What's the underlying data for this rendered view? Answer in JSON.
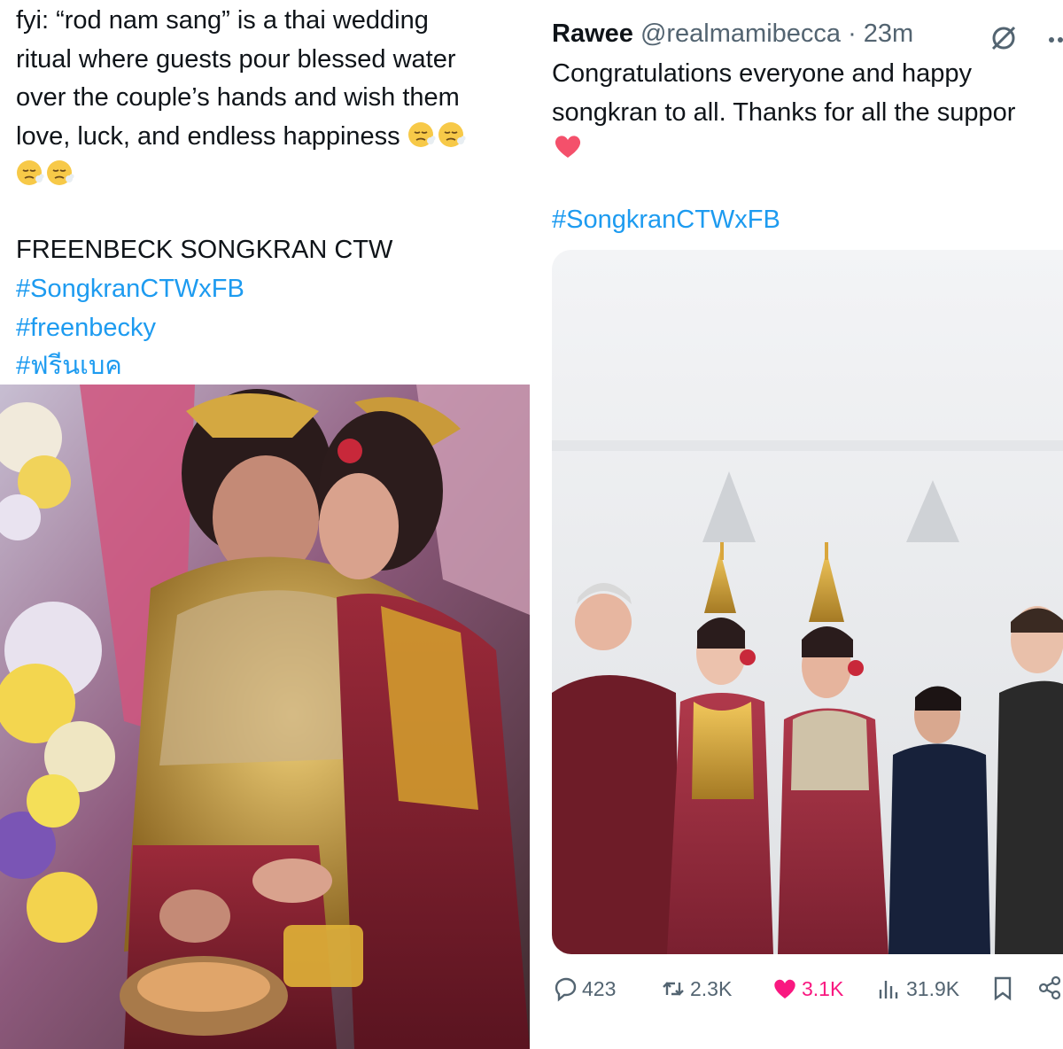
{
  "left_post": {
    "lines": [
      "fyi: “rod nam sang” is a thai wedding",
      "ritual where guests pour blessed water",
      "over the couple’s hands and wish them",
      "love, luck, and endless happiness"
    ],
    "emoji_name": "face-exhaling",
    "emoji_count": 4,
    "title": "FREENBECK SONGKRAN CTW",
    "hashtags": [
      "#SongkranCTWxFB",
      "#freenbecky",
      "#ฟรีนเบค"
    ],
    "image_alt_icon": "photo"
  },
  "right_post": {
    "display_name": "Rawee",
    "handle_time": "@realmamibecca · 23m",
    "grok_icon": "grok-icon",
    "more_icon": "more-icon",
    "text_line_1": "Congratulations everyone and happy",
    "text_line_2": "songkran to all. Thanks for all the suppor",
    "emoji": "red-heart",
    "hashtag": "#SongkranCTWxFB",
    "stats": {
      "replies": "423",
      "reposts": "2.3K",
      "likes": "3.1K",
      "views": "31.9K"
    }
  },
  "colors": {
    "text": "#0f1419",
    "secondary": "#536471",
    "link": "#1d9bf0",
    "like": "#f91880"
  }
}
